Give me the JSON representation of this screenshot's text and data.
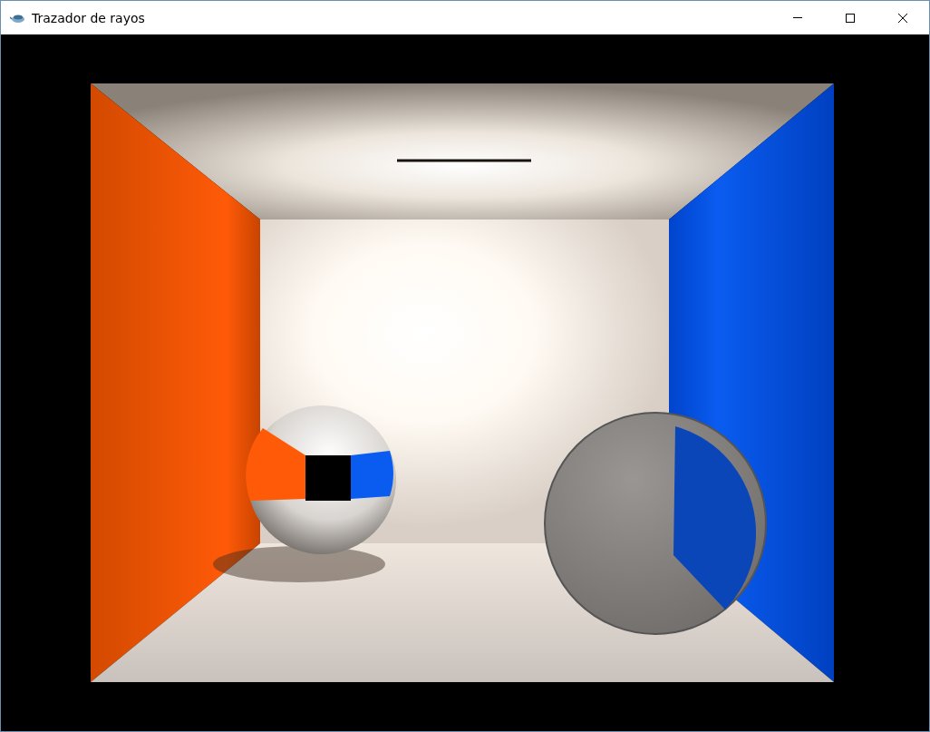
{
  "window": {
    "title": "Trazador de rayos"
  }
}
